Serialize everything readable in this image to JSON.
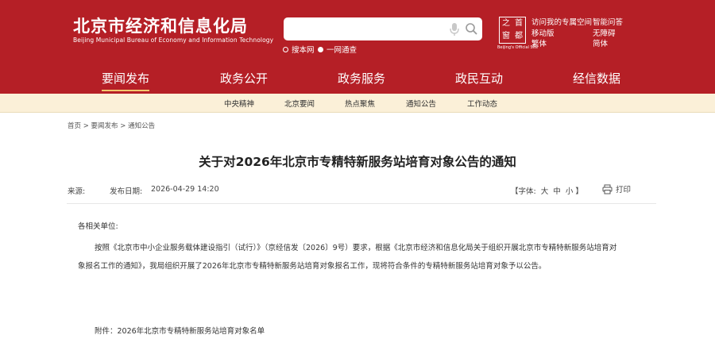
{
  "header": {
    "logo_cn": "北京市经济和信息化局",
    "logo_en": "Beijing Municipal Bureau of Economy and Information Technology",
    "search": {
      "placeholder": "",
      "scope_site": "搜本网",
      "scope_portal": "一网通查"
    },
    "seal": {
      "chars": [
        "首",
        "之",
        "都",
        "窗"
      ],
      "caption": "Beijing's Official Site"
    },
    "links": {
      "my_portal": "访问我的专属空间",
      "smart_qa": "智能问答",
      "mobile": "移动版",
      "barrier_free": "无障碍",
      "traditional": "繁体",
      "simplified": "简体"
    }
  },
  "mainnav": {
    "items": [
      "要闻发布",
      "政务公开",
      "政务服务",
      "政民互动",
      "经信数据"
    ],
    "active": "要闻发布"
  },
  "subnav": {
    "items": [
      "中央精神",
      "北京要闻",
      "热点聚焦",
      "通知公告",
      "工作动态"
    ]
  },
  "breadcrumb": {
    "items": [
      "首页",
      "要闻发布",
      "通知公告"
    ],
    "separator": ">"
  },
  "article": {
    "title": "关于对2026年北京市专精特新服务站培育对象公告的通知",
    "source_label": "来源:",
    "date_label": "发布日期:",
    "date": "2026-04-29 14:20",
    "font_label": "【字体:",
    "font_sizes": [
      "大",
      "中",
      "小"
    ],
    "font_close": "】",
    "print_label": "打印",
    "salutation": "各相关单位:",
    "para_line1": "按照《北京市中小企业服务载体建设指引（试行）》（京经信发〔2026〕9号）要求，根据《北京市经济和信息化局关于组织开展北京市专精特新服务站培育对",
    "para_line2": "象报名工作的通知》，我局组织开展了2026年北京市专精特新服务站培育对象报名工作，现将符合条件的专精特新服务站培育对象予以公告。",
    "attachment": "附件：2026年北京市专精特新服务站培育对象名单"
  },
  "colors": {
    "brand_red": "#b51f26",
    "subnav_bg": "#fbf0d8",
    "active_underline": "#f3c76e"
  },
  "icons": [
    "microphone-icon",
    "search-icon",
    "print-icon"
  ]
}
